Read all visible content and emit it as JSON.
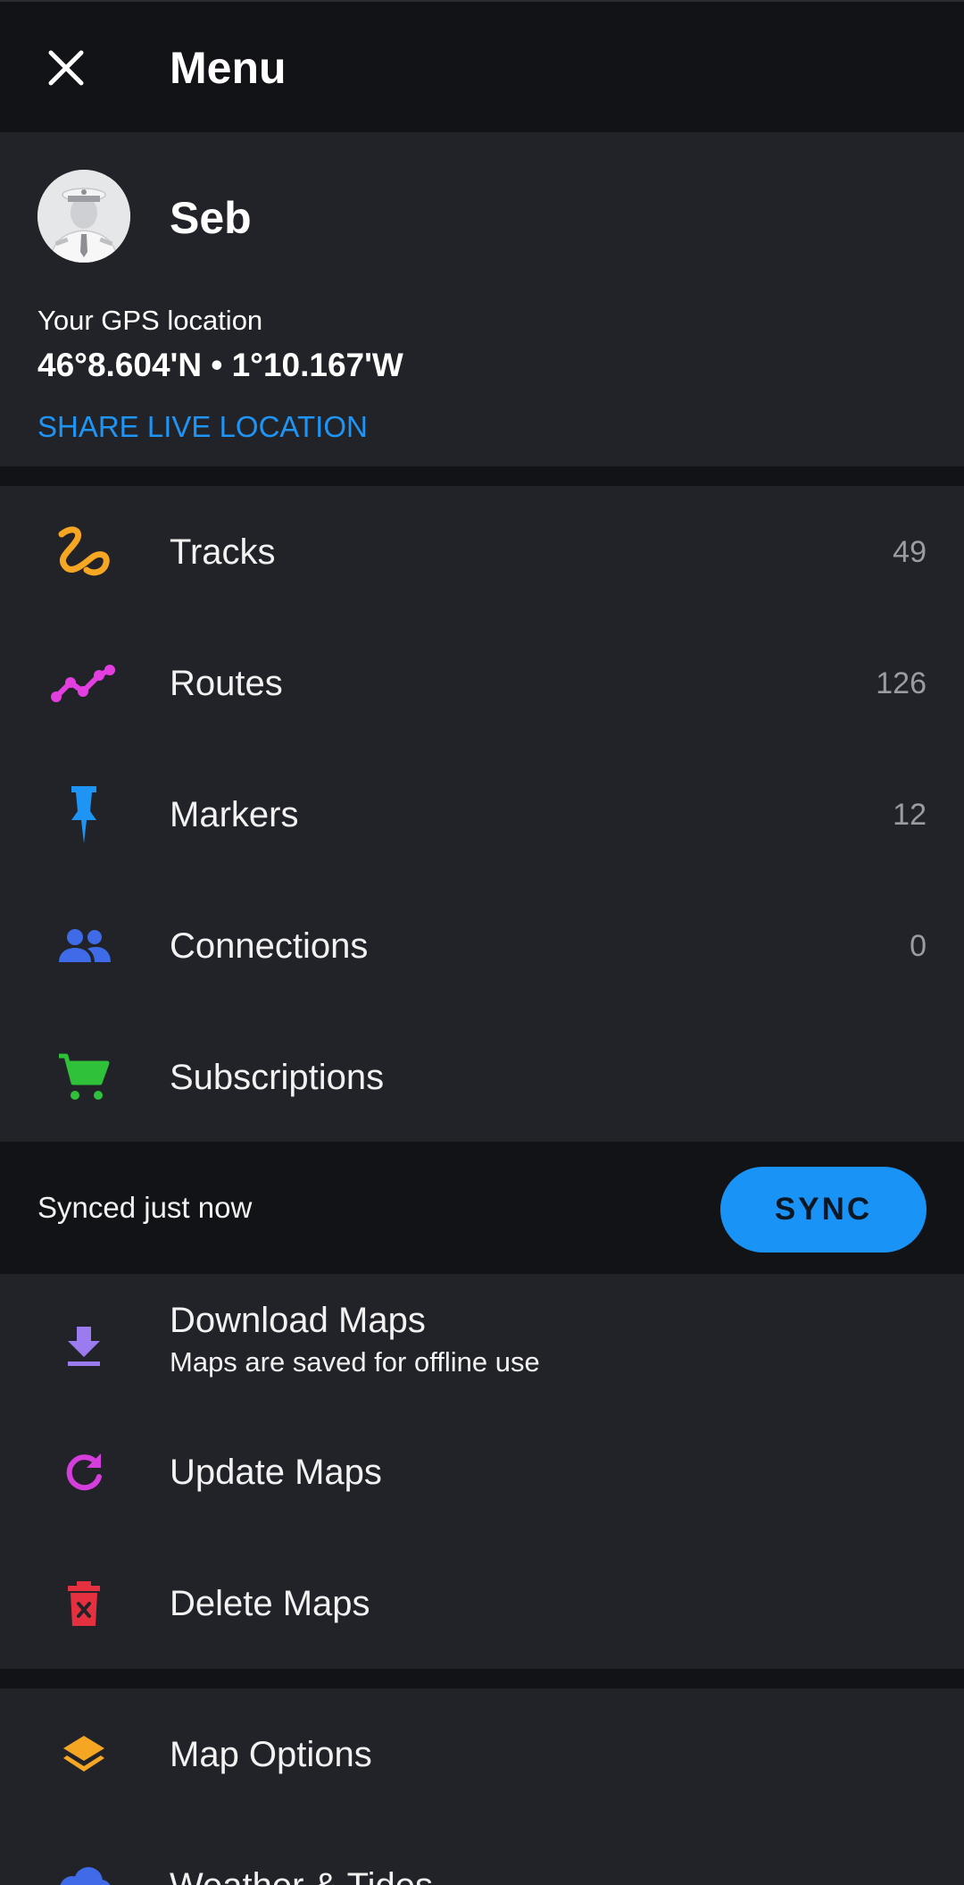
{
  "topbar": {
    "title": "Menu",
    "close_icon": "close-icon"
  },
  "profile": {
    "name": "Seb",
    "gps_label": "Your GPS location",
    "gps_coords": "46°8.604'N • 1°10.167'W",
    "share_link": "SHARE LIVE LOCATION"
  },
  "menu": {
    "items": [
      {
        "label": "Tracks",
        "count": "49",
        "icon": "tracks-icon",
        "color": "#f5a623"
      },
      {
        "label": "Routes",
        "count": "126",
        "icon": "routes-icon",
        "color": "#e23ee0"
      },
      {
        "label": "Markers",
        "count": "12",
        "icon": "pin-icon",
        "color": "#1e95f5"
      },
      {
        "label": "Connections",
        "count": "0",
        "icon": "people-icon",
        "color": "#3f6be8"
      },
      {
        "label": "Subscriptions",
        "count": "",
        "icon": "cart-icon",
        "color": "#2fc13a"
      }
    ]
  },
  "sync": {
    "status": "Synced just now",
    "button_label": "SYNC",
    "button_color": "#1a93f6"
  },
  "maps": {
    "items": [
      {
        "label": "Download Maps",
        "sublabel": "Maps are saved for offline use",
        "icon": "download-icon",
        "color": "#9b7cf0"
      },
      {
        "label": "Update Maps",
        "icon": "refresh-icon",
        "color": "#d63ddd"
      },
      {
        "label": "Delete Maps",
        "icon": "trash-icon",
        "color": "#e5303f"
      }
    ]
  },
  "options": {
    "items": [
      {
        "label": "Map Options",
        "icon": "layers-icon",
        "color": "#f5a623"
      },
      {
        "label": "Weather & Tides",
        "icon": "cloud-icon",
        "color": "#3f6be8"
      }
    ]
  }
}
